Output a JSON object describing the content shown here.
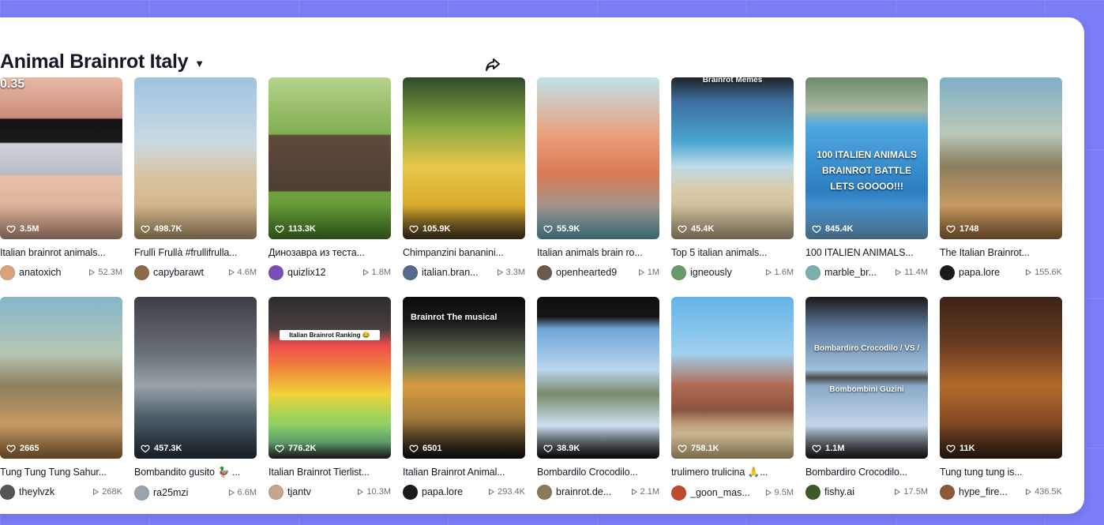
{
  "title": "Animal Brainrot Italy",
  "title_dropdown_icon": "chevron-down-icon",
  "share_icon": "share-arrow-icon",
  "videos": [
    {
      "likes": "3.5M",
      "caption": "Italian brainrot animals...",
      "author": "anatoxich",
      "views": "52.3M",
      "overlay": "0.35",
      "bg": "linear-gradient(180deg,#e8b9a6 0%,#c98c78 25%,#111 26%,#1a1a1a 40%,#cfd2d8 41%,#b8bcc4 60%,#e6c1a8 61%,#d4a48a 100%)",
      "avatar": "#d8a27b"
    },
    {
      "likes": "498.7K",
      "caption": "Frullì Frullà #frullifrulla...",
      "author": "capybarawt",
      "views": "4.6M",
      "overlay": "",
      "bg": "linear-gradient(180deg,#9fc4e0 0%,#c9d9e4 40%,#d9c39d 62%,#c5a878 100%)",
      "avatar": "#8a6a47"
    },
    {
      "likes": "113.3K",
      "caption": "Динозавра из теста...",
      "author": "quizlix12",
      "views": "1.8M",
      "overlay": "",
      "bg": "linear-gradient(180deg,#b7d38e 0%,#7fae4f 35%,#5f4b3c 36%,#4e3d31 70%,#6fa23c 71%,#4d8a2b 100%)",
      "avatar": "#7a4fb5"
    },
    {
      "likes": "105.9K",
      "caption": "Chimpanzini bananini...",
      "author": "italian.bran...",
      "views": "3.3M",
      "overlay": "",
      "bg": "linear-gradient(180deg,#2f4a2a 0%,#88a83f 30%,#e7c74a 55%,#d8a92c 80%,#4b3a21 100%)",
      "avatar": "#556a8c"
    },
    {
      "likes": "55.9K",
      "caption": "Italian animals brain ro...",
      "author": "openhearted9",
      "views": "1M",
      "overlay": "",
      "bg": "linear-gradient(180deg,#bfe3ea 0%,#e9a07a 35%,#d97a56 60%,#6ab3c4 100%)",
      "avatar": "#6b5a4e"
    },
    {
      "likes": "45.4K",
      "caption": "Top 5 italian animals...",
      "author": "igneously",
      "views": "1.6M",
      "overlay": "Brainrot Memes",
      "bg": "linear-gradient(180deg,#202428 0%,#3d6f9e 15%,#4ba6d1 40%,#bfdbe7 55%,#d9c9a8 70%,#c2b08a 100%)",
      "avatar": "#6a9a6a"
    },
    {
      "likes": "845.4K",
      "caption": "100 ITALIEN ANIMALS...",
      "author": "marble_br...",
      "views": "11.4M",
      "overlay": "100 ITALIEN ANIMALS BRAINROT BATTLE LETS GOOOO!!!",
      "bg": "linear-gradient(180deg,#6f8a6a 0%,#a9b8a0 20%,#4fa8e0 30%,#2b7ec2 70%,#76b6e3 100%)",
      "avatar": "#7ab0b0"
    },
    {
      "likes": "1748",
      "caption": "The Italian Brainrot...",
      "author": "papa.lore",
      "views": "155.6K",
      "overlay": "",
      "bg": "linear-gradient(180deg,#7fb0c7 0%,#b8c8b8 35%,#8a7d5c 55%,#c99a62 80%,#a5743e 100%)",
      "avatar": "#1b1b1b"
    },
    {
      "likes": "2665",
      "caption": "Tung Tung Tung Sahur...",
      "author": "theylvzk",
      "views": "268K",
      "overlay": "",
      "bg": "linear-gradient(180deg,#86b6ca 0%,#b6c6b4 35%,#8d7f5d 55%,#c89b63 80%,#a77640 100%)",
      "avatar": "#555555"
    },
    {
      "likes": "457.3K",
      "caption": "Bombandito gusito 🦆 ...",
      "author": "ra25mzi",
      "views": "6.6M",
      "overlay": "",
      "bg": "linear-gradient(180deg,#3b3f44 0%,#6b7178 35%,#9aa1a7 55%,#4a5b66 75%,#2a3640 100%)",
      "avatar": "#9aa4ae"
    },
    {
      "likes": "776.2K",
      "caption": "Italian Brainrot Tierlist...",
      "author": "tjantv",
      "views": "10.3M",
      "overlay": "Italian Brainrot Ranking 😂",
      "bg": "linear-gradient(180deg,#2c2c2c 0%,#4a4040 20%,#f04b4b 30%,#f08a3a 45%,#f0d23a 60%,#9bd35a 75%,#7acb8a 90%,#2d2d2d 100%)",
      "avatar": "#c5a58c"
    },
    {
      "likes": "6501",
      "caption": "Italian Brainrot Animal...",
      "author": "papa.lore",
      "views": "293.4K",
      "overlay": "Brainrot The musical",
      "bg": "linear-gradient(180deg,#0b0b0b 0%,#1a1a1a 15%,#6c7a5a 40%,#d69b3f 55%,#a37a3c 75%,#121212 100%)",
      "avatar": "#1b1b1b"
    },
    {
      "likes": "38.9K",
      "caption": "Bombardilo Crocodilo...",
      "author": "brainrot.de...",
      "views": "2.1M",
      "overlay": "",
      "bg": "linear-gradient(180deg,#0e0e0e 0%,#141414 12%,#6fa6d9 20%,#b9d6ee 45%,#7a8a6a 60%,#cfe3f2 80%,#0e0e0e 100%)",
      "avatar": "#8a7a5a"
    },
    {
      "likes": "758.1K",
      "caption": "trulimero trulicina 🙏...",
      "author": "_goon_mas...",
      "views": "9.5M",
      "overlay": "",
      "bg": "linear-gradient(180deg,#64b4e8 0%,#9fd0ee 35%,#b06a52 55%,#8a5440 70%,#e6d2a6 85%,#d8be88 100%)",
      "avatar": "#c14a2a"
    },
    {
      "likes": "1.1M",
      "caption": "Bombardiro Crocodilo...",
      "author": "fishy.ai",
      "views": "17.5M",
      "overlay": "Bombardiro Crocodilo / VS / Bombombini Guzini",
      "bg": "linear-gradient(180deg,#1a1a1a 0%,#5f7fa0 20%,#9fc0de 45%,#4c4c4c 50%,#87a9c8 55%,#c4d8ea 80%,#1a1a1a 100%)",
      "avatar": "#3d5a2a"
    },
    {
      "likes": "11K",
      "caption": "Tung tung tung is...",
      "author": "hype_fire...",
      "views": "436.5K",
      "overlay": "",
      "bg": "linear-gradient(180deg,#3a2418 0%,#6a3c20 30%,#b26a2c 55%,#8a4e22 75%,#3a2418 100%)",
      "avatar": "#8a5a3a"
    }
  ],
  "colors": {
    "background": "#7b7ef5",
    "panel": "#ffffff",
    "text_primary": "#161823",
    "text_secondary": "#6e6f77"
  }
}
